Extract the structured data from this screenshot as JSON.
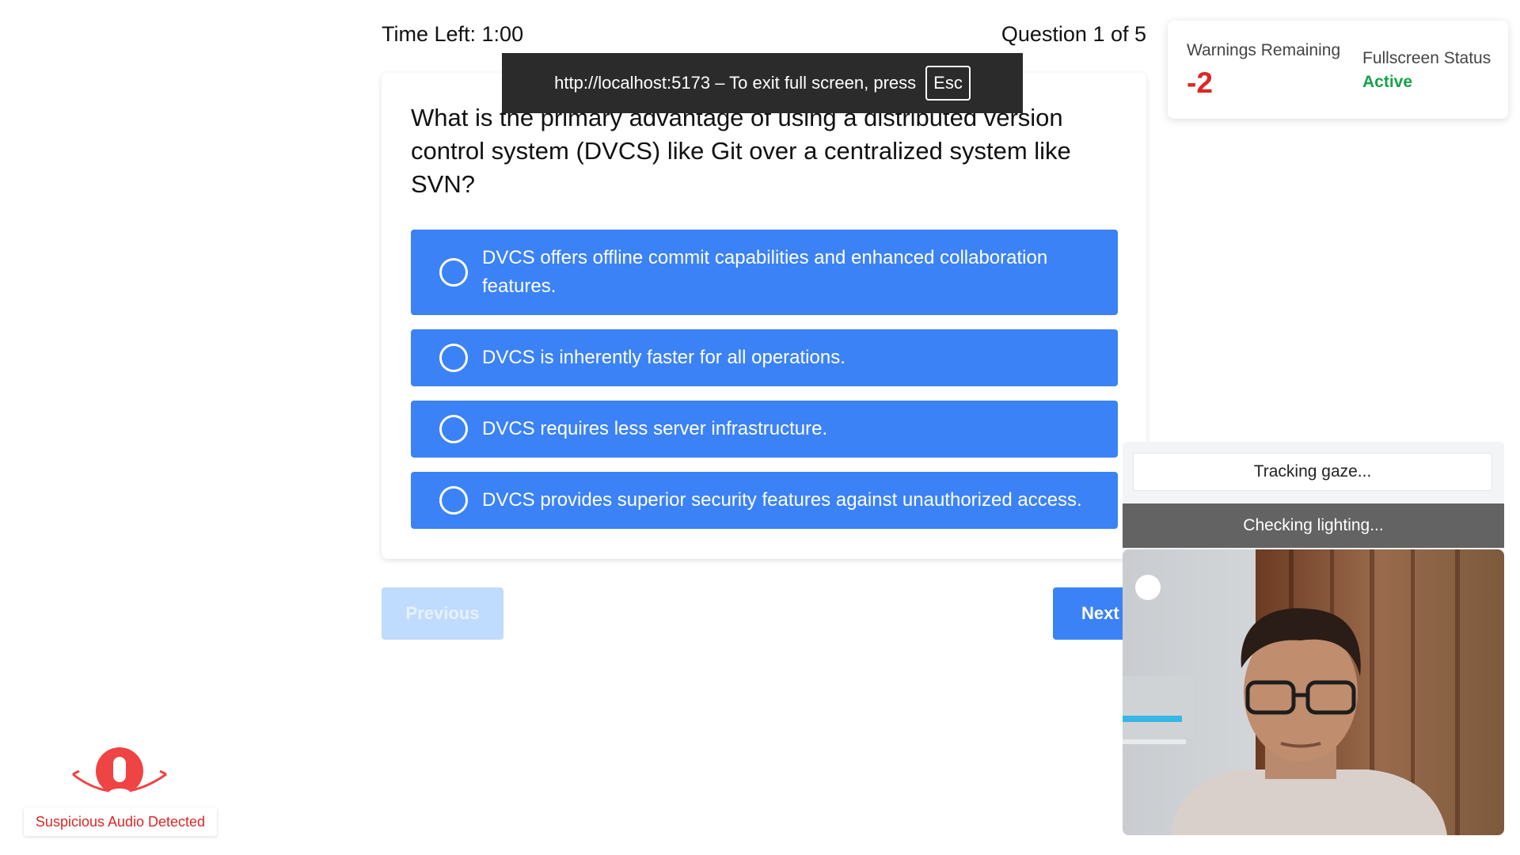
{
  "header": {
    "timer": "Time Left: 1:00",
    "question_counter": "Question 1 of 5"
  },
  "fullscreen_banner": {
    "message": "http://localhost:5173 – To exit full screen, press",
    "key": "Esc"
  },
  "question": {
    "text": "What is the primary advantage of using a distributed version control system (DVCS) like Git over a centralized system like SVN?",
    "options": [
      "DVCS offers offline commit capabilities and enhanced collaboration features.",
      "DVCS is inherently faster for all operations.",
      "DVCS requires less server infrastructure.",
      "DVCS provides superior security features against unauthorized access."
    ]
  },
  "navigation": {
    "previous_label": "Previous",
    "next_label": "Next"
  },
  "status": {
    "warnings_label": "Warnings Remaining",
    "warnings_value": "-2",
    "fullscreen_label": "Fullscreen Status",
    "fullscreen_value": "Active"
  },
  "proctoring": {
    "gaze_status": "Tracking gaze...",
    "lighting_status": "Checking lighting..."
  },
  "audio_alert": {
    "label": "Suspicious Audio Detected"
  },
  "colors": {
    "accent": "#3b82f6",
    "warning": "#dc2626",
    "success": "#16a34a"
  }
}
